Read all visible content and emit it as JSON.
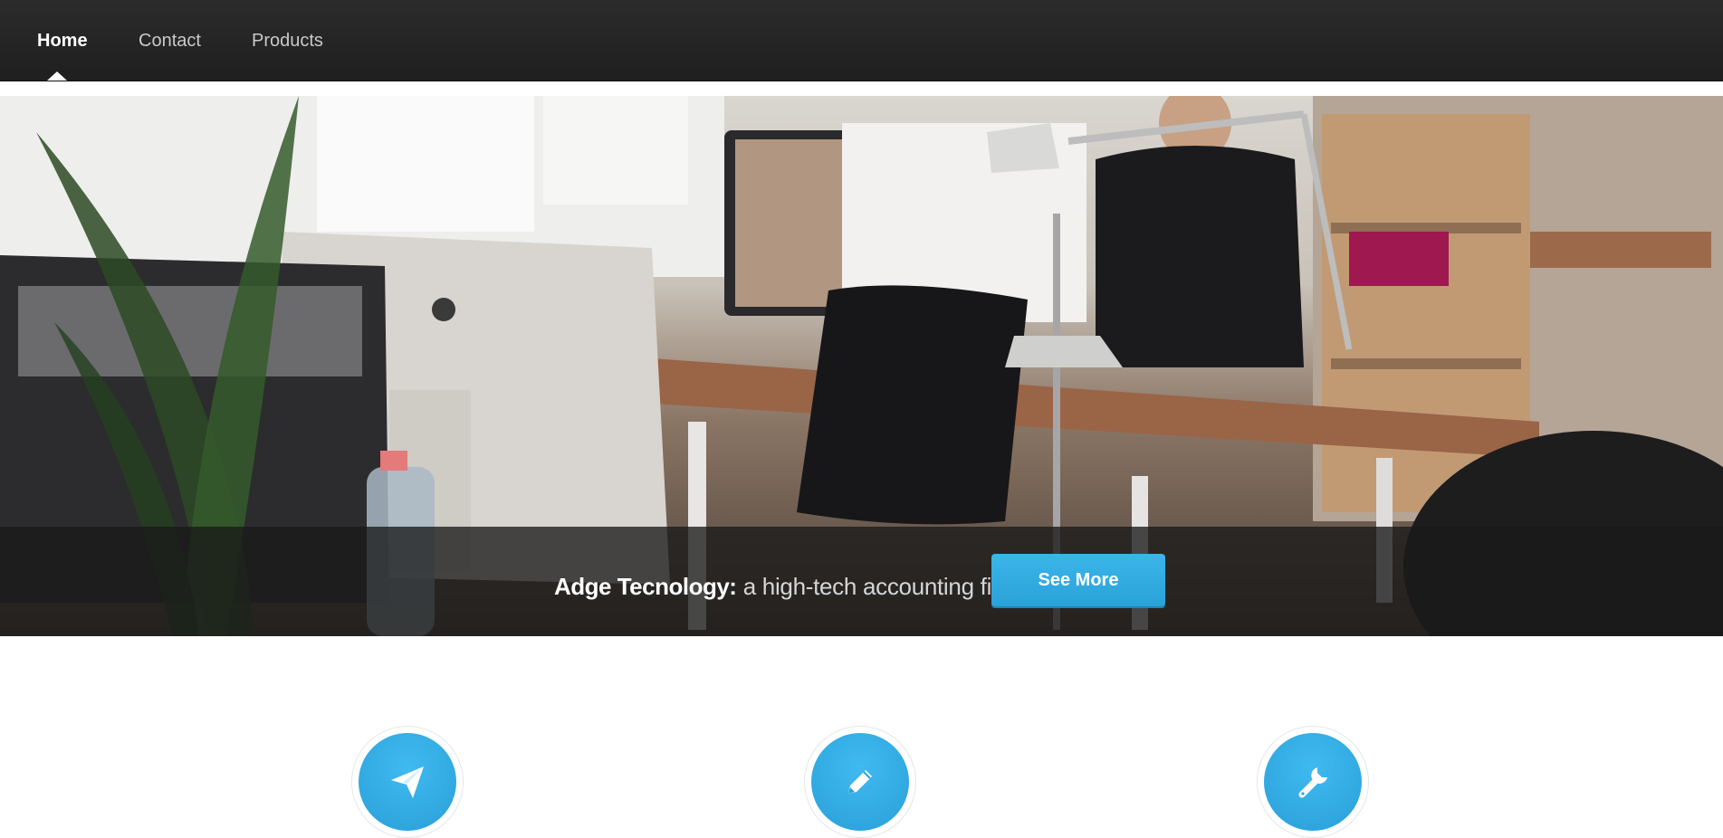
{
  "nav": {
    "items": [
      {
        "label": "Home",
        "active": true
      },
      {
        "label": "Contact",
        "active": false
      },
      {
        "label": "Products",
        "active": false
      }
    ]
  },
  "hero": {
    "brand": "Adge Tecnology:",
    "tagline": "a high-tech accounting firm",
    "button_label": "See More"
  },
  "features": [
    {
      "icon": "paper-plane-icon"
    },
    {
      "icon": "pencil-icon"
    },
    {
      "icon": "wrench-icon"
    }
  ],
  "colors": {
    "nav_bg": "#262626",
    "accent": "#33ade4",
    "hero_overlay": "#191919"
  }
}
